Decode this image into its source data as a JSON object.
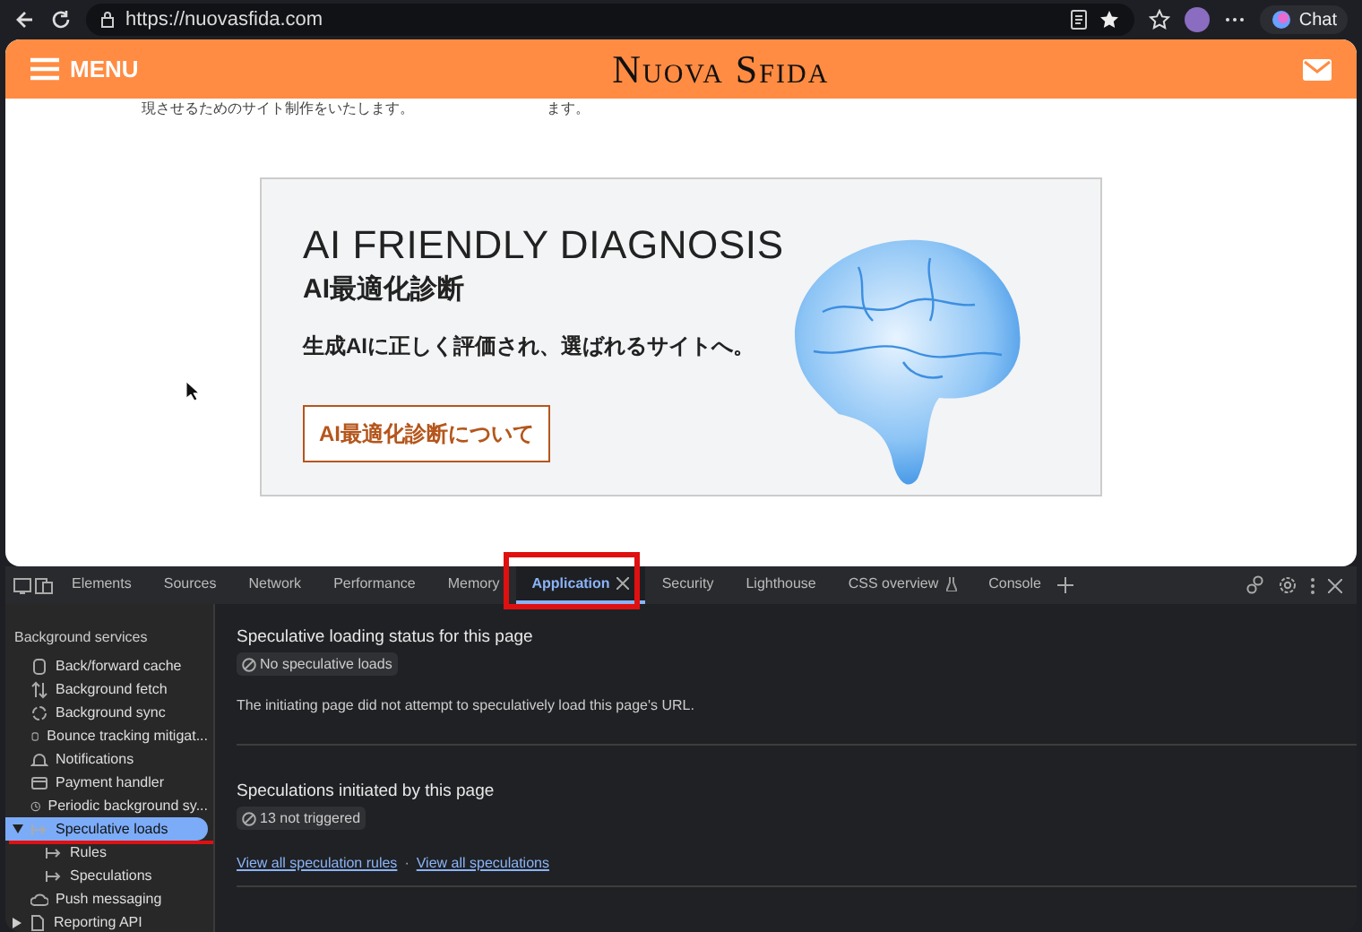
{
  "browser": {
    "url": "https://nuovasfida.com",
    "chat_label": "Chat"
  },
  "site": {
    "menu_label": "MENU",
    "logo": "Nuova Sfida",
    "intro_lines": [
      "現させるためのサイト制作をいたします。",
      "ます。"
    ],
    "banner": {
      "title": "AI FRIENDLY DIAGNOSIS",
      "subtitle": "AI最適化診断",
      "tagline": "生成AIに正しく評価され、選ばれるサイトへ。",
      "button": "AI最適化診断について"
    }
  },
  "devtools": {
    "tabs": [
      {
        "label": "Elements",
        "selected": false
      },
      {
        "label": "Sources",
        "selected": false
      },
      {
        "label": "Network",
        "selected": false
      },
      {
        "label": "Performance",
        "selected": false
      },
      {
        "label": "Memory",
        "selected": false
      },
      {
        "label": "Application",
        "selected": true
      },
      {
        "label": "Security",
        "selected": false
      },
      {
        "label": "Lighthouse",
        "selected": false
      },
      {
        "label": "CSS overview",
        "selected": false
      },
      {
        "label": "Console",
        "selected": false
      }
    ],
    "sidebar": {
      "section": "Background services",
      "items": [
        {
          "label": "Back/forward cache",
          "kind": "db",
          "selected": false
        },
        {
          "label": "Background fetch",
          "kind": "updown",
          "selected": false
        },
        {
          "label": "Background sync",
          "kind": "sync",
          "selected": false
        },
        {
          "label": "Bounce tracking mitigat...",
          "kind": "db",
          "selected": false
        },
        {
          "label": "Notifications",
          "kind": "bell",
          "selected": false
        },
        {
          "label": "Payment handler",
          "kind": "card",
          "selected": false
        },
        {
          "label": "Periodic background sy...",
          "kind": "clock",
          "selected": false
        },
        {
          "label": "Speculative loads",
          "kind": "arrow",
          "selected": true,
          "expanded": true,
          "children": [
            {
              "label": "Rules",
              "kind": "arrow",
              "selected": false
            },
            {
              "label": "Speculations",
              "kind": "arrow",
              "selected": false
            }
          ]
        },
        {
          "label": "Push messaging",
          "kind": "cloud",
          "selected": false
        },
        {
          "label": "Reporting API",
          "kind": "file",
          "selected": false,
          "expanded": false
        }
      ]
    },
    "sections": [
      {
        "title": "Speculative loading status for this page",
        "badge": "No speculative loads",
        "text": "The initiating page did not attempt to speculatively load this page's URL."
      },
      {
        "title": "Speculations initiated by this page",
        "badge": "13 not triggered",
        "links": [
          "View all speculation rules",
          "View all speculations"
        ],
        "link_separator": "·"
      }
    ]
  }
}
